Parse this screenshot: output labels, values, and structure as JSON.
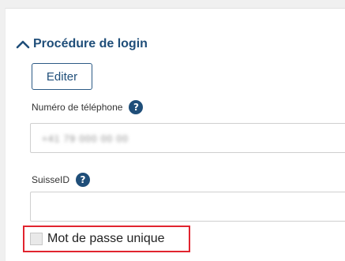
{
  "section": {
    "title": "Procédure de login",
    "edit_label": "Editer"
  },
  "fields": {
    "phone": {
      "label": "Numéro de téléphone",
      "value": "+41 79 000 00 00",
      "help_icon": "question-mark-icon"
    },
    "suisseid": {
      "label": "SuisseID",
      "value": "",
      "help_icon": "question-mark-icon"
    }
  },
  "otp": {
    "label": "Mot de passe unique",
    "checked": false
  },
  "colors": {
    "primary": "#1f4e79",
    "highlight": "#e1242f"
  }
}
